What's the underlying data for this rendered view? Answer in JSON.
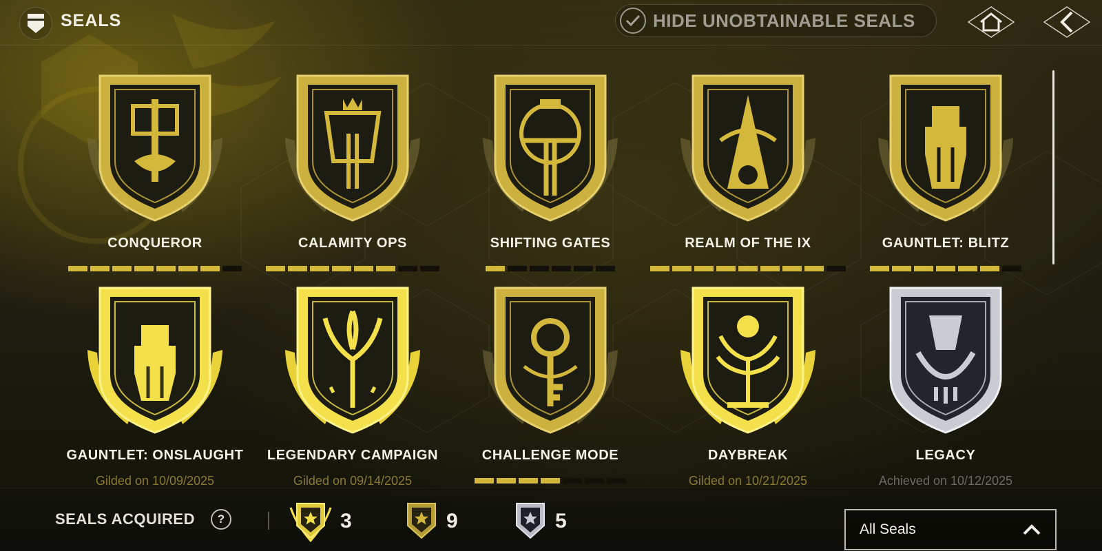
{
  "header": {
    "title": "SEALS",
    "hide_toggle_label": "HIDE UNOBTAINABLE SEALS",
    "hide_toggle_checked": true
  },
  "seals": [
    {
      "name": "CONQUEROR",
      "tier": "gold",
      "progress": {
        "filled": 7,
        "total": 8
      }
    },
    {
      "name": "CALAMITY OPS",
      "tier": "gold",
      "progress": {
        "filled": 6,
        "total": 8
      }
    },
    {
      "name": "SHIFTING GATES",
      "tier": "gold",
      "progress": {
        "filled": 1,
        "total": 6
      }
    },
    {
      "name": "REALM OF THE IX",
      "tier": "gold",
      "progress": {
        "filled": 8,
        "total": 9
      }
    },
    {
      "name": "GAUNTLET: BLITZ",
      "tier": "gold",
      "progress": {
        "filled": 6,
        "total": 7
      }
    },
    {
      "name": "GAUNTLET: ONSLAUGHT",
      "tier": "gilded",
      "subtitle": "Gilded on 10/09/2025"
    },
    {
      "name": "LEGENDARY CAMPAIGN",
      "tier": "gilded",
      "subtitle": "Gilded on 09/14/2025"
    },
    {
      "name": "CHALLENGE MODE",
      "tier": "gold",
      "progress": {
        "filled": 4,
        "total": 7
      }
    },
    {
      "name": "DAYBREAK",
      "tier": "gilded",
      "subtitle": "Gilded on 10/21/2025"
    },
    {
      "name": "LEGACY",
      "tier": "silver",
      "subtitle": "Achieved on 10/12/2025"
    }
  ],
  "footer": {
    "acquired_label": "SEALS ACQUIRED",
    "help_label": "?",
    "counts": [
      {
        "tier": "gilded",
        "value": "3"
      },
      {
        "tier": "gold",
        "value": "9"
      },
      {
        "tier": "silver",
        "value": "5"
      }
    ],
    "filter": {
      "selected": "All Seals"
    }
  },
  "colors": {
    "gold": "#d4b83b",
    "gilded": "#f3e04a",
    "silver": "#c9ccd2",
    "track": "#111109"
  }
}
